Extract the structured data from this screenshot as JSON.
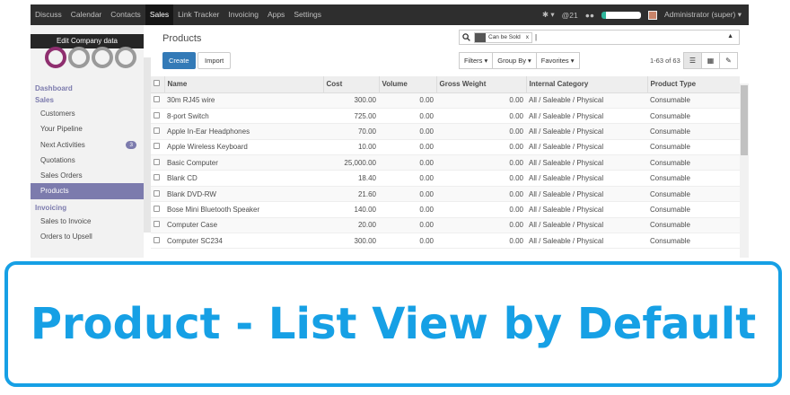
{
  "topbar": {
    "menu": [
      "Discuss",
      "Calendar",
      "Contacts",
      "Sales",
      "Link Tracker",
      "Invoicing",
      "Apps",
      "Settings"
    ],
    "active": "Sales",
    "bug_label": "✱ ▾",
    "mention_label": "@21",
    "chat_label": "●●",
    "user": "Administrator (super) ▾"
  },
  "sidebar": {
    "edit_company": "Edit Company data",
    "sections": [
      {
        "title": "Dashboard",
        "items": []
      },
      {
        "title": "Sales",
        "items": [
          {
            "label": "Customers"
          },
          {
            "label": "Your Pipeline"
          },
          {
            "label": "Next Activities",
            "badge": "3"
          },
          {
            "label": "Quotations"
          },
          {
            "label": "Sales Orders"
          },
          {
            "label": "Products",
            "active": true
          }
        ]
      },
      {
        "title": "Invoicing",
        "items": [
          {
            "label": "Sales to Invoice"
          },
          {
            "label": "Orders to Upsell"
          }
        ]
      }
    ]
  },
  "control": {
    "title": "Products",
    "create": "Create",
    "import": "Import",
    "facet": "Can be Sold",
    "facet_close": "x",
    "filters": "Filters ▾",
    "group_by": "Group By ▾",
    "favorites": "Favorites ▾",
    "pager": "1-63 of 63"
  },
  "table": {
    "columns": [
      "Name",
      "Cost",
      "Volume",
      "Gross Weight",
      "Internal Category",
      "Product Type"
    ],
    "rows": [
      [
        "30m RJ45 wire",
        "300.00",
        "0.00",
        "0.00",
        "All / Saleable / Physical",
        "Consumable"
      ],
      [
        "8-port Switch",
        "725.00",
        "0.00",
        "0.00",
        "All / Saleable / Physical",
        "Consumable"
      ],
      [
        "Apple In-Ear Headphones",
        "70.00",
        "0.00",
        "0.00",
        "All / Saleable / Physical",
        "Consumable"
      ],
      [
        "Apple Wireless Keyboard",
        "10.00",
        "0.00",
        "0.00",
        "All / Saleable / Physical",
        "Consumable"
      ],
      [
        "Basic Computer",
        "25,000.00",
        "0.00",
        "0.00",
        "All / Saleable / Physical",
        "Consumable"
      ],
      [
        "Blank CD",
        "18.40",
        "0.00",
        "0.00",
        "All / Saleable / Physical",
        "Consumable"
      ],
      [
        "Blank DVD-RW",
        "21.60",
        "0.00",
        "0.00",
        "All / Saleable / Physical",
        "Consumable"
      ],
      [
        "Bose Mini Bluetooth Speaker",
        "140.00",
        "0.00",
        "0.00",
        "All / Saleable / Physical",
        "Consumable"
      ],
      [
        "Computer Case",
        "20.00",
        "0.00",
        "0.00",
        "All / Saleable / Physical",
        "Consumable"
      ],
      [
        "Computer SC234",
        "300.00",
        "0.00",
        "0.00",
        "All / Saleable / Physical",
        "Consumable"
      ]
    ]
  },
  "banner": {
    "text": "Product - List View by Default"
  },
  "colors": {
    "accent": "#7c7bad",
    "primary": "#337ab7",
    "banner": "#16a0e5",
    "topbar": "#2e2e2e"
  }
}
